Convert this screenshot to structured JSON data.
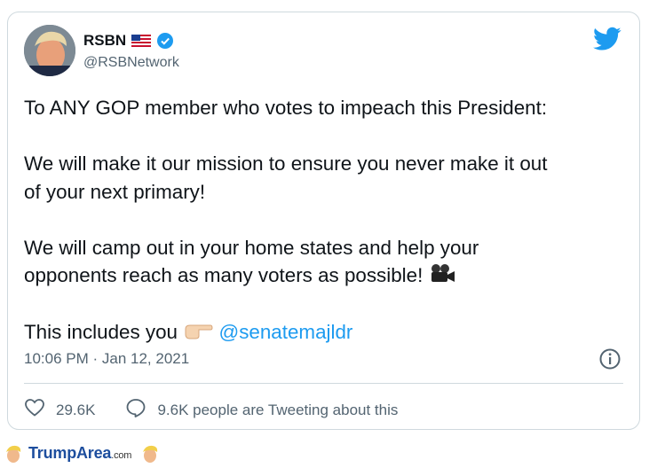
{
  "tweet": {
    "author_name": "RSBN",
    "author_handle": "@RSBNetwork",
    "lines": {
      "l1": "To ANY GOP member who votes to impeach this President:",
      "l2": "We will make it our mission to ensure you never make it out",
      "l3": "of your next primary!",
      "l4": "We will camp out in your home states and help your",
      "l5": "opponents reach as many voters as possible!",
      "l6": "This includes you",
      "mention": "@senatemajldr"
    },
    "timestamp": "10:06 PM · Jan 12, 2021",
    "likes": "29.6K",
    "retweets_text": "9.6K people are Tweeting about this"
  },
  "footer": {
    "brand_main": "TrumpArea",
    "brand_tld": ".com"
  },
  "colors": {
    "accent": "#1d9bf0",
    "secondary_text": "#536471",
    "border": "#cfd9de"
  },
  "icons": [
    "twitter-bird-icon",
    "verified-badge-icon",
    "us-flag-icon",
    "movie-camera-emoji-icon",
    "pointing-hand-emoji-icon",
    "info-icon",
    "heart-icon",
    "speech-bubble-icon"
  ]
}
